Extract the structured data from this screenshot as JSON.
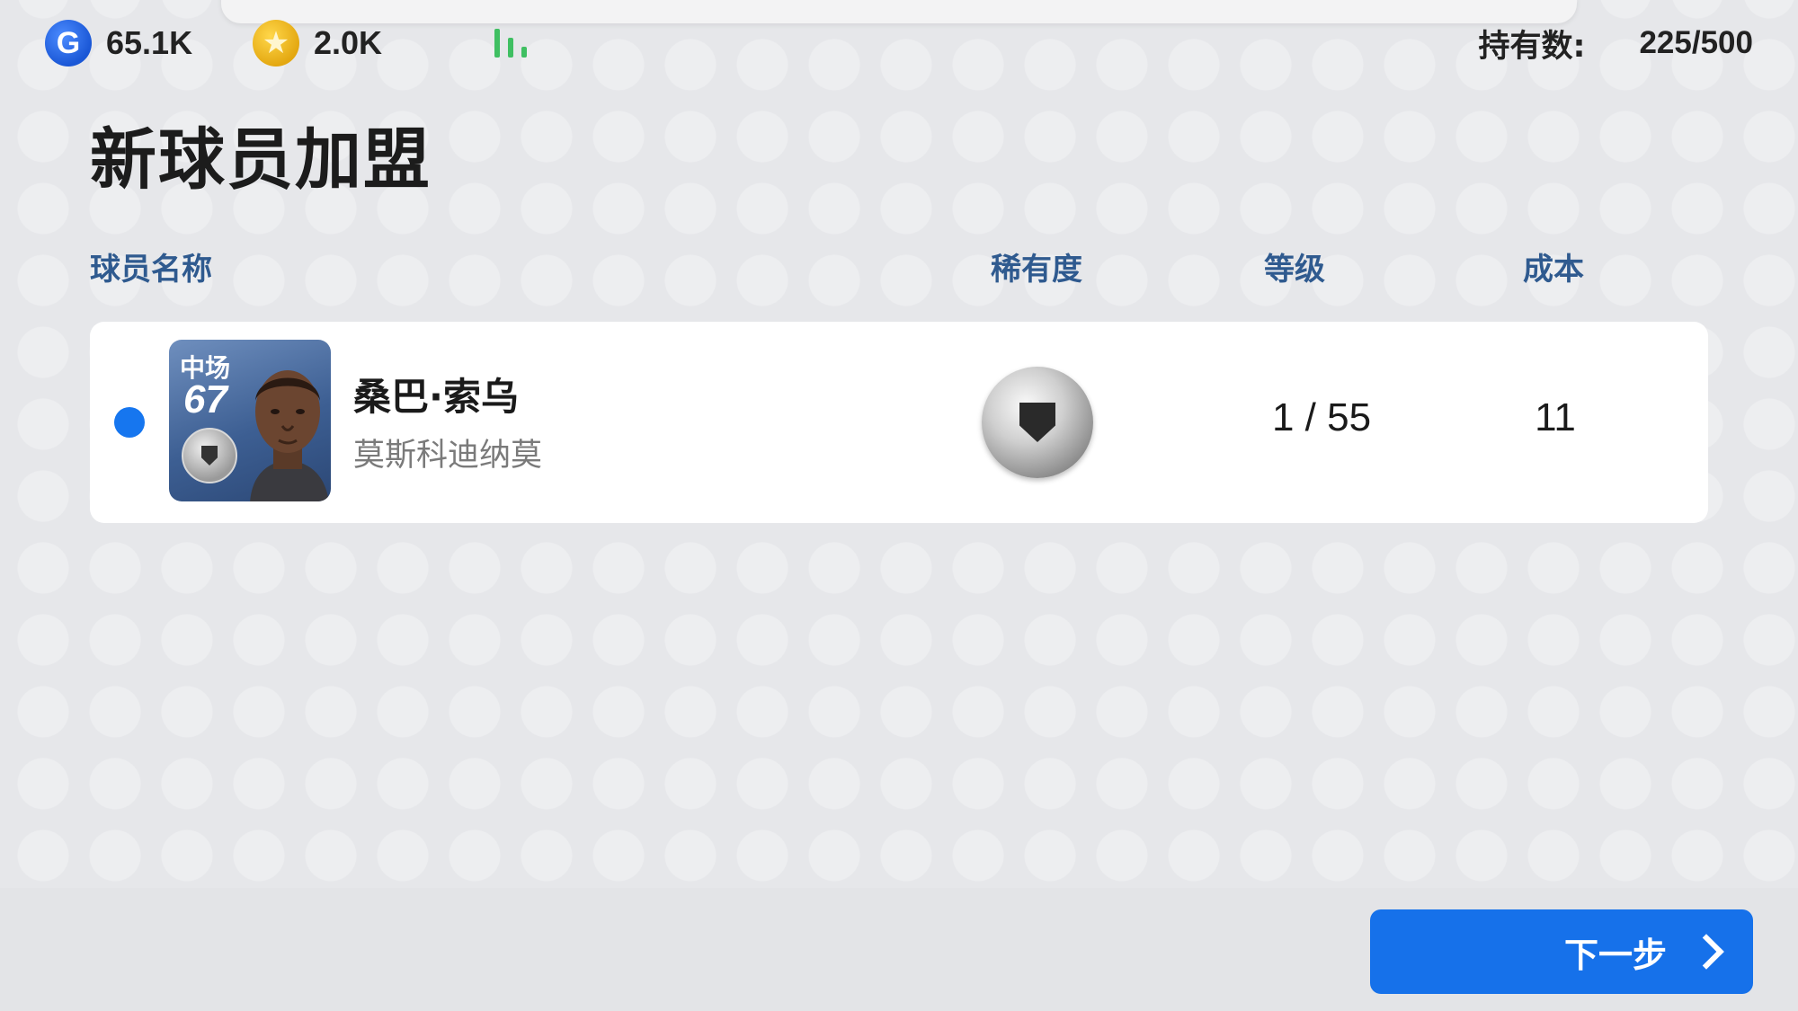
{
  "header": {
    "gp": {
      "icon": "gp-coin-icon",
      "letter": "G",
      "value": "65.1K",
      "color": "#1f63e0"
    },
    "coins": {
      "icon": "star-coin-icon",
      "glyph": "★",
      "value": "2.0K",
      "color": "#f0b51b"
    },
    "signal": {
      "icon": "signal-strength-icon",
      "color": "#3fbf62"
    },
    "holdings": {
      "label": "持有数:",
      "value": "225/500"
    }
  },
  "page": {
    "title": "新球员加盟"
  },
  "table": {
    "headers": {
      "name": "球员名称",
      "rarity": "稀有度",
      "level": "等级",
      "cost": "成本"
    },
    "rows": [
      {
        "position": "中场",
        "rating": "67",
        "name": "桑巴·索乌",
        "club": "莫斯科迪纳莫",
        "rarity_icon": "silver-ball-icon",
        "level": "1 / 55",
        "cost": "11",
        "selected": true
      }
    ]
  },
  "footer": {
    "next_label": "下一步",
    "next_icon": "chevron-right-icon",
    "accent": "#1671ea"
  }
}
